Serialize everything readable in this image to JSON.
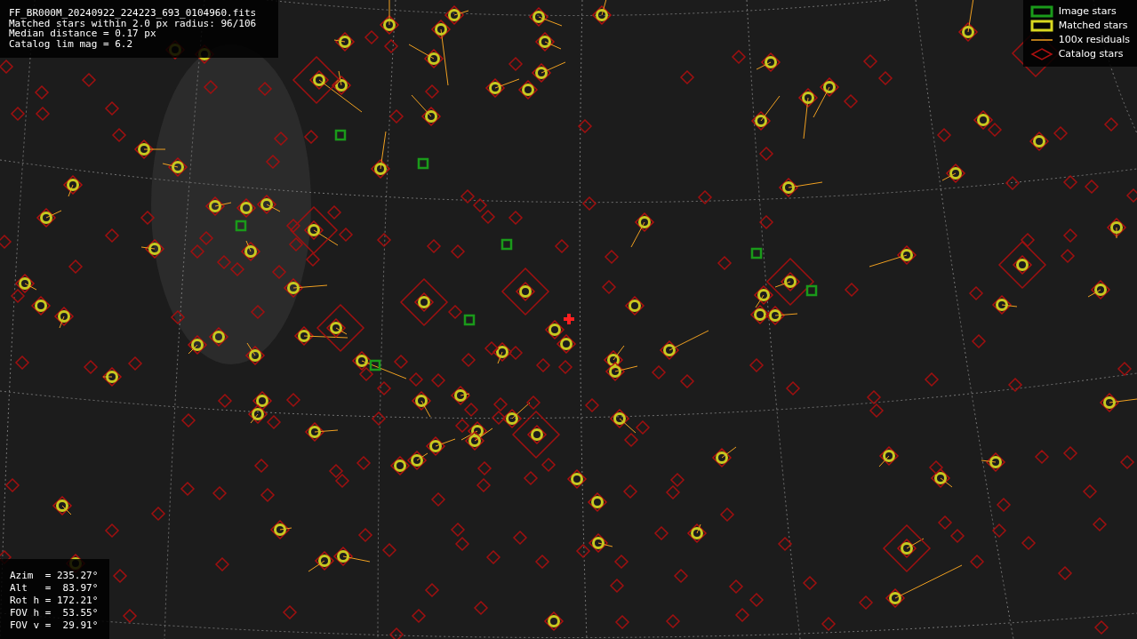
{
  "header": {
    "lines": [
      "FF_BR000M_20240922_224223_693_0104960.fits",
      "Matched stars within 2.0 px radius: 96/106",
      "Median distance = 0.17 px",
      "Catalog lim mag = 6.2"
    ]
  },
  "legend": {
    "items": [
      {
        "kind": "image",
        "label": "Image stars"
      },
      {
        "kind": "matched",
        "label": "Matched stars"
      },
      {
        "kind": "residual",
        "label": "100x residuals"
      },
      {
        "kind": "catalog",
        "label": "Catalog stars"
      }
    ]
  },
  "pointing": {
    "lines": [
      "Azim  = 235.27°",
      "Alt   =  83.97°",
      "Rot h = 172.21°",
      "FOV h =  53.55°",
      "FOV v =  29.91°"
    ]
  }
}
